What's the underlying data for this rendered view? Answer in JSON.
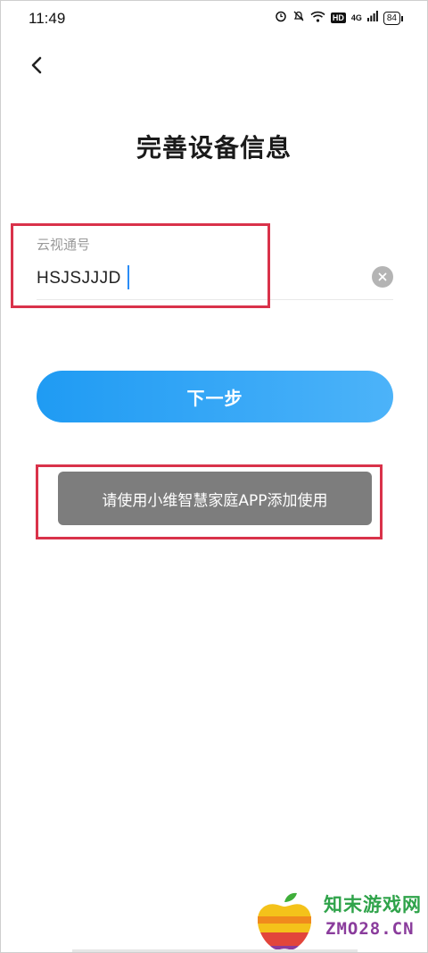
{
  "status_bar": {
    "time": "11:49",
    "hd_badge": "HD",
    "network": "4G",
    "battery": "84"
  },
  "header": {
    "back_icon": "chevron-left-icon",
    "title": "完善设备信息"
  },
  "form": {
    "field_label": "云视通号",
    "field_value": "HSJSJJJD",
    "clear_icon": "clear-circle-icon"
  },
  "actions": {
    "next_label": "下一步"
  },
  "toast": {
    "message": "请使用小维智慧家庭APP添加使用"
  },
  "watermark": {
    "title": "知末游戏网",
    "domain": "ZMO28.CN"
  },
  "colors": {
    "accent": "#2a9ff5",
    "highlight": "#d9324a",
    "toast_bg": "#7d7d7d"
  }
}
